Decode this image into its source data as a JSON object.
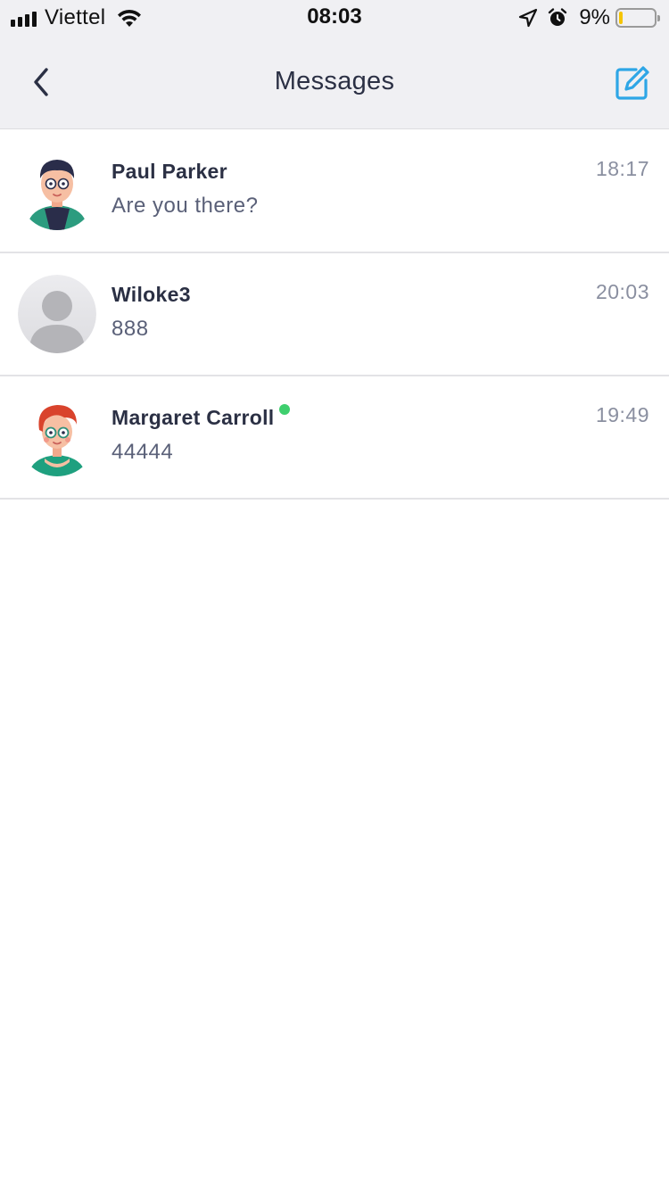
{
  "status_bar": {
    "carrier": "Viettel",
    "time": "08:03",
    "battery_percent_label": "9%",
    "battery_level": 0.09,
    "battery_color": "#f5c400",
    "icons": [
      "signal-icon",
      "wifi-icon",
      "location-arrow-icon",
      "alarm-icon",
      "battery-icon"
    ]
  },
  "header": {
    "title": "Messages",
    "back_icon": "chevron-left-icon",
    "compose_icon": "compose-icon",
    "accent_color": "#2ea6e6"
  },
  "conversations": [
    {
      "name": "Paul Parker",
      "preview": "Are you there?",
      "time": "18:17",
      "online": false,
      "avatar": "paul-parker-avatar"
    },
    {
      "name": "Wiloke3",
      "preview": "888",
      "time": "20:03",
      "online": false,
      "avatar": "default-user-avatar"
    },
    {
      "name": "Margaret Carroll",
      "preview": "44444",
      "time": "19:49",
      "online": true,
      "avatar": "margaret-carroll-avatar"
    }
  ],
  "online_color": "#3ecf6e"
}
